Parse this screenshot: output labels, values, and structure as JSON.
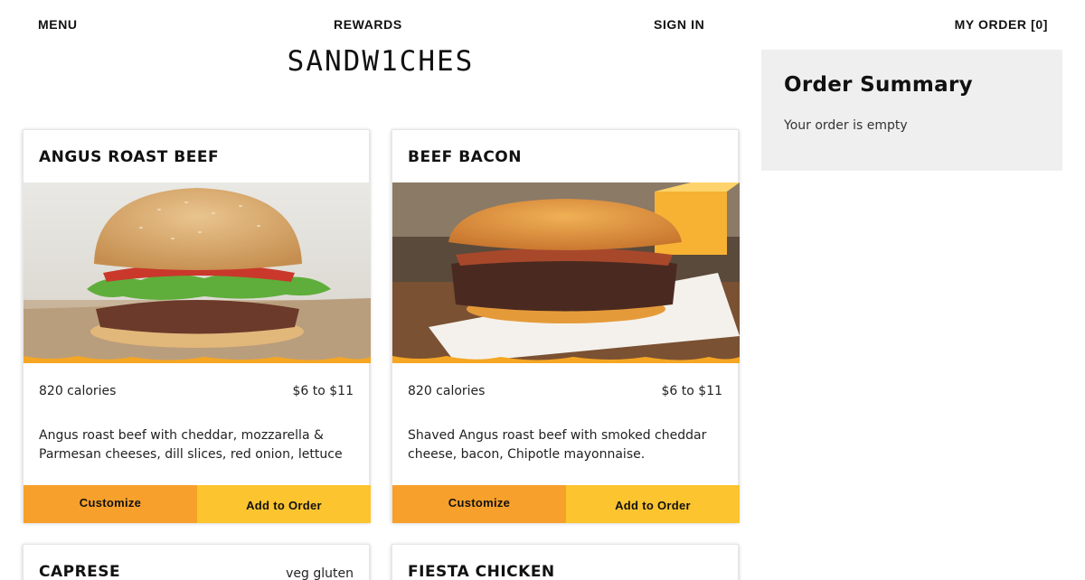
{
  "nav": {
    "menu": "MENU",
    "rewards": "REWARDS",
    "sign_in": "SIGN IN",
    "my_order": "MY ORDER [0]"
  },
  "page_title": "SANDW1CHES",
  "summary": {
    "title": "Order Summary",
    "empty_text": "Your order is empty"
  },
  "products": [
    {
      "name": "ANGUS ROAST BEEF",
      "calories": "820 calories",
      "price": "$6 to $11",
      "description": "Angus roast beef with cheddar, mozzarella & Parmesan cheeses, dill slices, red onion, lettuce",
      "customize_label": "Customize",
      "add_label": "Add to Order"
    },
    {
      "name": "BEEF BACON",
      "calories": "820 calories",
      "price": "$6 to $11",
      "description": "Shaved Angus roast beef with smoked cheddar cheese, bacon, Chipotle mayonnaise.",
      "customize_label": "Customize",
      "add_label": "Add to Order"
    },
    {
      "name": "CAPRESE",
      "tags": "veg gluten"
    },
    {
      "name": "FIESTA CHICKEN"
    }
  ],
  "colors": {
    "customize_bg": "#f7a02b",
    "add_bg": "#fcc42f",
    "summary_bg": "#efefef",
    "accent_drip": "#f5a623"
  }
}
